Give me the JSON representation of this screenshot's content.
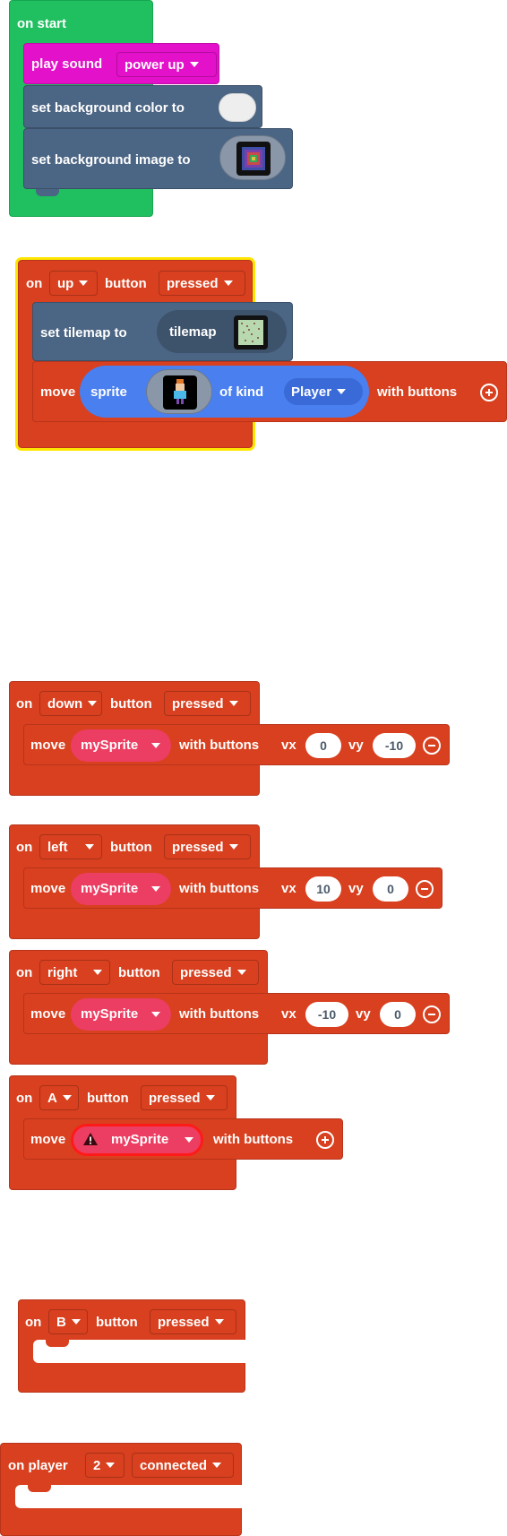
{
  "on_start": {
    "title": "on start",
    "play_sound": {
      "label": "play sound",
      "value": "power up"
    },
    "set_bg_color": {
      "label": "set background color to"
    },
    "set_bg_image": {
      "label": "set background image to"
    }
  },
  "up_block": {
    "on": "on",
    "button_value": "up",
    "button": "button",
    "event_value": "pressed",
    "set_tilemap": {
      "label": "set tilemap to",
      "tilemap": "tilemap"
    },
    "move": "move",
    "sprite": {
      "label": "sprite",
      "of_kind": "of kind",
      "kind": "Player"
    },
    "with_buttons": "with buttons"
  },
  "down_block": {
    "on": "on",
    "button_value": "down",
    "button": "button",
    "event_value": "pressed",
    "move": "move",
    "sprite": "mySprite",
    "with_buttons": "with buttons",
    "vx_label": "vx",
    "vx": "0",
    "vy_label": "vy",
    "vy": "-10"
  },
  "left_block": {
    "on": "on",
    "button_value": "left",
    "button": "button",
    "event_value": "pressed",
    "move": "move",
    "sprite": "mySprite",
    "with_buttons": "with buttons",
    "vx_label": "vx",
    "vx": "10",
    "vy_label": "vy",
    "vy": "0"
  },
  "right_block": {
    "on": "on",
    "button_value": "right",
    "button": "button",
    "event_value": "pressed",
    "move": "move",
    "sprite": "mySprite",
    "with_buttons": "with buttons",
    "vx_label": "vx",
    "vx": "-10",
    "vy_label": "vy",
    "vy": "0"
  },
  "a_block": {
    "on": "on",
    "button_value": "A",
    "button": "button",
    "event_value": "pressed",
    "move": "move",
    "sprite": "mySprite",
    "with_buttons": "with buttons"
  },
  "b_block": {
    "on": "on",
    "button_value": "B",
    "button": "button",
    "event_value": "pressed"
  },
  "player_block": {
    "on_player": "on player",
    "player_value": "2",
    "event_value": "connected"
  },
  "colors": {
    "event_red": "#d8401f",
    "on_start_green": "#20bf60",
    "music_magenta": "#e311c9",
    "scene_slate": "#4b6584",
    "sprite_blue": "#4a7ff0",
    "variable_crimson": "#ec3d62",
    "selection_yellow": "#ffe600"
  }
}
